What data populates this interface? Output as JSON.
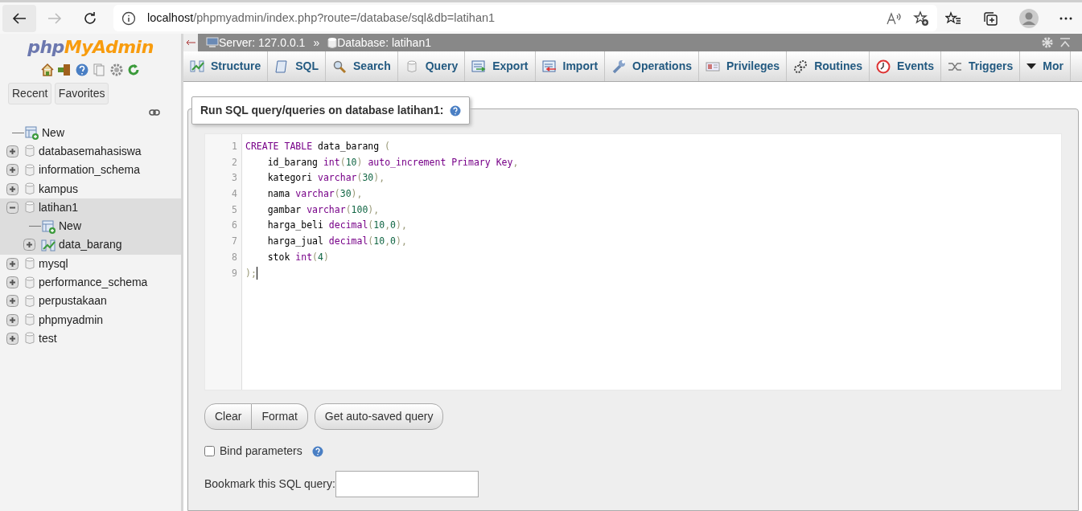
{
  "browser": {
    "url_host": "localhost",
    "url_path": "/phpmyadmin/index.php?route=/database/sql&db=latihan1"
  },
  "sidebar": {
    "logo": [
      "php",
      "MyAdmin"
    ],
    "buttons": [
      "Recent",
      "Favorites"
    ],
    "tree": [
      {
        "label": "New",
        "kind": "new"
      },
      {
        "label": "databasemahasiswa",
        "kind": "database",
        "expanded": false,
        "selected": false
      },
      {
        "label": "information_schema",
        "kind": "database",
        "expanded": false,
        "selected": false
      },
      {
        "label": "kampus",
        "kind": "database",
        "expanded": false,
        "selected": false
      },
      {
        "label": "latihan1",
        "kind": "database",
        "expanded": true,
        "selected": true,
        "children": [
          {
            "label": "New",
            "kind": "new"
          },
          {
            "label": "data_barang",
            "kind": "table",
            "expanded": false
          }
        ]
      },
      {
        "label": "mysql",
        "kind": "database",
        "expanded": false,
        "selected": false
      },
      {
        "label": "performance_schema",
        "kind": "database",
        "expanded": false,
        "selected": false
      },
      {
        "label": "perpustakaan",
        "kind": "database",
        "expanded": false,
        "selected": false
      },
      {
        "label": "phpmyadmin",
        "kind": "database",
        "expanded": false,
        "selected": false
      },
      {
        "label": "test",
        "kind": "database",
        "expanded": false,
        "selected": false
      }
    ]
  },
  "breadcrumb": {
    "server": "Server: 127.0.0.1",
    "separator": "»",
    "database": "Database: latihan1"
  },
  "tabs": [
    {
      "label": "Structure",
      "selected": false
    },
    {
      "label": "SQL",
      "selected": false
    },
    {
      "label": "Search",
      "selected": false
    },
    {
      "label": "Query",
      "selected": false
    },
    {
      "label": "Export",
      "selected": false
    },
    {
      "label": "Import",
      "selected": false
    },
    {
      "label": "Operations",
      "selected": false
    },
    {
      "label": "Privileges",
      "selected": false
    },
    {
      "label": "Routines",
      "selected": false
    },
    {
      "label": "Events",
      "selected": false
    },
    {
      "label": "Triggers",
      "selected": false
    },
    {
      "label": "Mor",
      "selected": false
    }
  ],
  "query_panel": {
    "legend": "Run SQL query/queries on database latihan1:",
    "editor_lines": [
      [
        {
          "text": "CREATE ",
          "kind": "keyword"
        },
        {
          "text": "TABLE",
          "kind": "keyword"
        },
        {
          "text": " data_barang ",
          "kind": "plain"
        },
        {
          "text": "(",
          "kind": "punct"
        }
      ],
      [
        {
          "text": "    id_barang ",
          "kind": "plain"
        },
        {
          "text": "int",
          "kind": "keyword"
        },
        {
          "text": "(",
          "kind": "punct"
        },
        {
          "text": "10",
          "kind": "number"
        },
        {
          "text": ") ",
          "kind": "punct"
        },
        {
          "text": "auto_increment ",
          "kind": "keyword"
        },
        {
          "text": "Primary ",
          "kind": "keyword"
        },
        {
          "text": "Key",
          "kind": "keyword"
        },
        {
          "text": ",",
          "kind": "punct"
        }
      ],
      [
        {
          "text": "    kategori ",
          "kind": "plain"
        },
        {
          "text": "varchar",
          "kind": "keyword"
        },
        {
          "text": "(",
          "kind": "punct"
        },
        {
          "text": "30",
          "kind": "number"
        },
        {
          "text": "),",
          "kind": "punct"
        }
      ],
      [
        {
          "text": "    nama ",
          "kind": "plain"
        },
        {
          "text": "varchar",
          "kind": "keyword"
        },
        {
          "text": "(",
          "kind": "punct"
        },
        {
          "text": "30",
          "kind": "number"
        },
        {
          "text": "),",
          "kind": "punct"
        }
      ],
      [
        {
          "text": "    gambar ",
          "kind": "plain"
        },
        {
          "text": "varchar",
          "kind": "keyword"
        },
        {
          "text": "(",
          "kind": "punct"
        },
        {
          "text": "100",
          "kind": "number"
        },
        {
          "text": "),",
          "kind": "punct"
        }
      ],
      [
        {
          "text": "    harga_beli ",
          "kind": "plain"
        },
        {
          "text": "decimal",
          "kind": "keyword"
        },
        {
          "text": "(",
          "kind": "punct"
        },
        {
          "text": "10",
          "kind": "number"
        },
        {
          "text": ",",
          "kind": "punct"
        },
        {
          "text": "0",
          "kind": "number"
        },
        {
          "text": "),",
          "kind": "punct"
        }
      ],
      [
        {
          "text": "    harga_jual ",
          "kind": "plain"
        },
        {
          "text": "decimal",
          "kind": "keyword"
        },
        {
          "text": "(",
          "kind": "punct"
        },
        {
          "text": "10",
          "kind": "number"
        },
        {
          "text": ",",
          "kind": "punct"
        },
        {
          "text": "0",
          "kind": "number"
        },
        {
          "text": "),",
          "kind": "punct"
        }
      ],
      [
        {
          "text": "    stok ",
          "kind": "plain"
        },
        {
          "text": "int",
          "kind": "keyword"
        },
        {
          "text": "(",
          "kind": "punct"
        },
        {
          "text": "4",
          "kind": "number"
        },
        {
          "text": ")",
          "kind": "punct"
        }
      ],
      [
        {
          "text": ");",
          "kind": "punct"
        }
      ]
    ],
    "line_numbers": [
      "1",
      "2",
      "3",
      "4",
      "5",
      "6",
      "7",
      "8",
      "9"
    ],
    "buttons": [
      "Clear",
      "Format"
    ],
    "autosave_button": "Get auto-saved query",
    "bind_parameters": {
      "label": "Bind parameters",
      "checked": false
    },
    "bookmark": {
      "label": "Bookmark this SQL query:"
    }
  }
}
